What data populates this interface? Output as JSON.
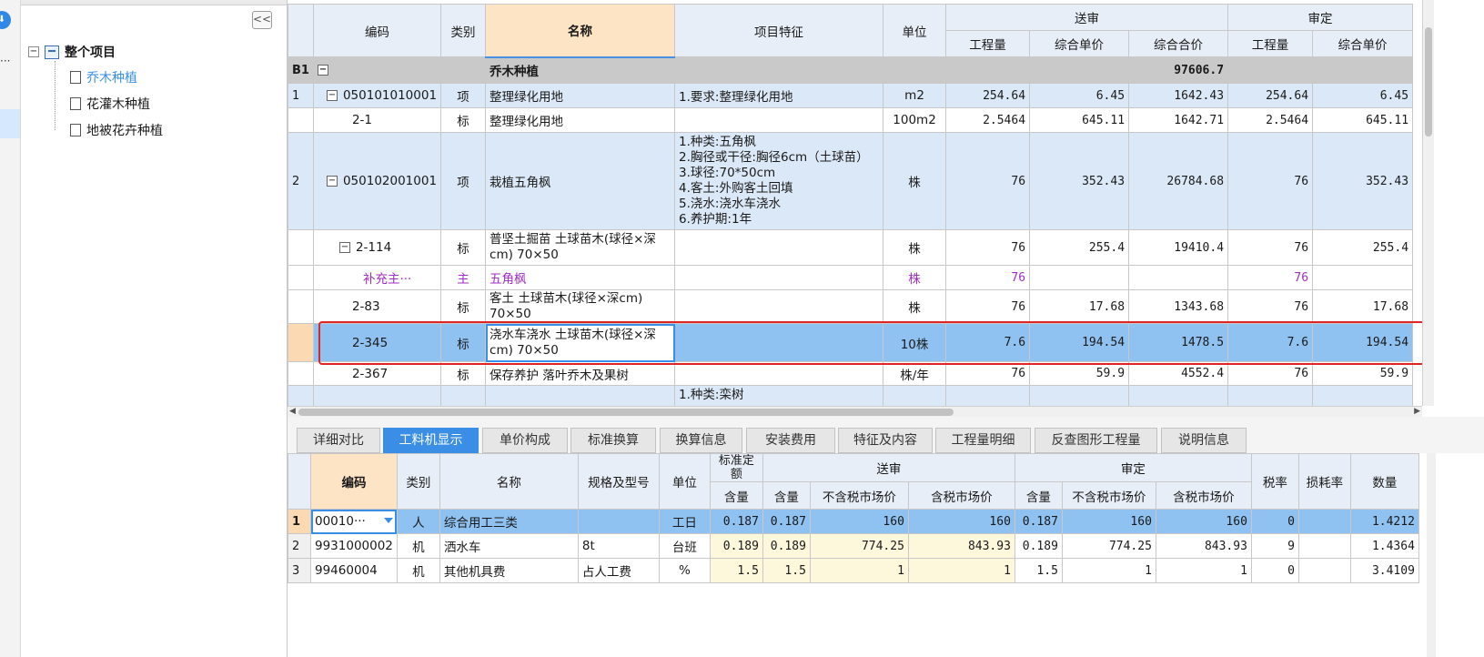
{
  "tree": {
    "root": "整个项目",
    "items": [
      "乔木种植",
      "花灌木种植",
      "地被花卉种植"
    ],
    "selected_index": 0,
    "collapse_label": "<<"
  },
  "grid": {
    "headers": {
      "code": "编码",
      "type": "类别",
      "name": "名称",
      "feature": "项目特征",
      "unit": "单位",
      "group_submit": "送审",
      "group_approve": "审定",
      "qty": "工程量",
      "unit_price": "综合单价",
      "total": "综合合价",
      "qty2": "工程量",
      "unit_price2": "综合单价"
    },
    "rows": [
      {
        "rn": "B1",
        "kind": "group",
        "toggle": "−",
        "code": "",
        "type": "",
        "name": "乔木种植",
        "feature": "",
        "unit": "",
        "qty": "",
        "unit_price": "",
        "total": "97606.7",
        "qty2": "",
        "unit_price2": ""
      },
      {
        "rn": "1",
        "kind": "blue",
        "toggle": "−",
        "code": "050101010001",
        "type": "项",
        "name": "整理绿化用地",
        "feature": "1.要求:整理绿化用地",
        "unit": "m2",
        "qty": "254.64",
        "unit_price": "6.45",
        "total": "1642.43",
        "qty2": "254.64",
        "unit_price2": "6.45"
      },
      {
        "rn": "",
        "kind": "white",
        "toggle": "",
        "code": "2-1",
        "type": "标",
        "name": "整理绿化用地",
        "feature": "",
        "unit": "100m2",
        "qty": "2.5464",
        "unit_price": "645.11",
        "total": "1642.71",
        "qty2": "2.5464",
        "unit_price2": "645.11"
      },
      {
        "rn": "2",
        "kind": "blue",
        "toggle": "−",
        "code": "050102001001",
        "type": "项",
        "name": "栽植五角枫",
        "feature": "1.种类:五角枫\n2.胸径或干径:胸径6cm（土球苗）\n3.球径:70*50cm\n4.客土:外购客土回填\n5.浇水:浇水车浇水\n6.养护期:1年",
        "unit": "株",
        "qty": "76",
        "unit_price": "352.43",
        "total": "26784.68",
        "qty2": "76",
        "unit_price2": "352.43"
      },
      {
        "rn": "",
        "kind": "white",
        "toggle": "−",
        "code": "2-114",
        "type": "标",
        "name": "普坚土掘苗 土球苗木(球径×深cm) 70×50",
        "feature": "",
        "unit": "株",
        "qty": "76",
        "unit_price": "255.4",
        "total": "19410.4",
        "qty2": "76",
        "unit_price2": "255.4"
      },
      {
        "rn": "",
        "kind": "purple",
        "toggle": "",
        "code": "补充主···",
        "type": "主",
        "name": "五角枫",
        "feature": "",
        "unit": "株",
        "qty": "76",
        "unit_price": "",
        "total": "",
        "qty2": "76",
        "unit_price2": ""
      },
      {
        "rn": "",
        "kind": "white",
        "toggle": "",
        "code": "2-83",
        "type": "标",
        "name": "客土 土球苗木(球径×深cm) 70×50",
        "feature": "",
        "unit": "株",
        "qty": "76",
        "unit_price": "17.68",
        "total": "1343.68",
        "qty2": "76",
        "unit_price2": "17.68"
      },
      {
        "rn": "",
        "kind": "sel",
        "toggle": "",
        "code": "2-345",
        "type": "标",
        "name": "浇水车浇水 土球苗木(球径×深cm) 70×50",
        "feature": "",
        "unit": "10株",
        "qty": "7.6",
        "unit_price": "194.54",
        "total": "1478.5",
        "qty2": "7.6",
        "unit_price2": "194.54"
      },
      {
        "rn": "",
        "kind": "white",
        "toggle": "",
        "code": "2-367",
        "type": "标",
        "name": "保存养护 落叶乔木及果树",
        "feature": "",
        "unit": "株/年",
        "qty": "76",
        "unit_price": "59.9",
        "total": "4552.4",
        "qty2": "76",
        "unit_price2": "59.9"
      },
      {
        "rn": "",
        "kind": "blue",
        "toggle": "",
        "code": "",
        "type": "",
        "name": "",
        "feature": "1.种类:栾树",
        "unit": "",
        "qty": "",
        "unit_price": "",
        "total": "",
        "qty2": "",
        "unit_price2": ""
      }
    ]
  },
  "tabs": [
    "详细对比",
    "工料机显示",
    "单价构成",
    "标准换算",
    "换算信息",
    "安装费用",
    "特征及内容",
    "工程量明细",
    "反查图形工程量",
    "说明信息"
  ],
  "active_tab": 1,
  "detail": {
    "headers": {
      "code": "编码",
      "type": "类别",
      "name": "名称",
      "spec": "规格及型号",
      "unit": "单位",
      "std_quota": "标准定额",
      "std_content": "含量",
      "group_submit": "送审",
      "group_approve": "审定",
      "content": "含量",
      "price_ex": "不含税市场价",
      "price_in": "含税市场价",
      "content2": "含量",
      "price_ex2": "不含税市场价",
      "price_in2": "含税市场价",
      "tax": "税率",
      "loss": "损耗率",
      "qty": "数量"
    },
    "rows": [
      {
        "rn": "1",
        "code": "00010···",
        "type": "人",
        "name": "综合用工三类",
        "spec": "",
        "unit": "工日",
        "std": "0.187",
        "content": "0.187",
        "price_ex": "160",
        "price_in": "160",
        "content2": "0.187",
        "price_ex2": "160",
        "price_in2": "160",
        "tax": "0",
        "loss": "",
        "qty": "1.4212"
      },
      {
        "rn": "2",
        "code": "9931000002",
        "type": "机",
        "name": "洒水车",
        "spec": "8t",
        "unit": "台班",
        "std": "0.189",
        "content": "0.189",
        "price_ex": "774.25",
        "price_in": "843.93",
        "content2": "0.189",
        "price_ex2": "774.25",
        "price_in2": "843.93",
        "tax": "9",
        "loss": "",
        "qty": "1.4364"
      },
      {
        "rn": "3",
        "code": "99460004",
        "type": "机",
        "name": "其他机具费",
        "spec": "占人工费",
        "unit": "%",
        "std": "1.5",
        "content": "1.5",
        "price_ex": "1",
        "price_in": "1",
        "content2": "1.5",
        "price_ex2": "1",
        "price_in2": "1",
        "tax": "0",
        "loss": "",
        "qty": "3.4109"
      }
    ]
  },
  "colors": {
    "accent": "#3a8ee6",
    "selected_row": "#8fc1f1",
    "highlight_border": "#e02424",
    "name_header": "#fde4c4",
    "group_row": "#c9c9c9",
    "supplement_text": "#a02cc5"
  }
}
